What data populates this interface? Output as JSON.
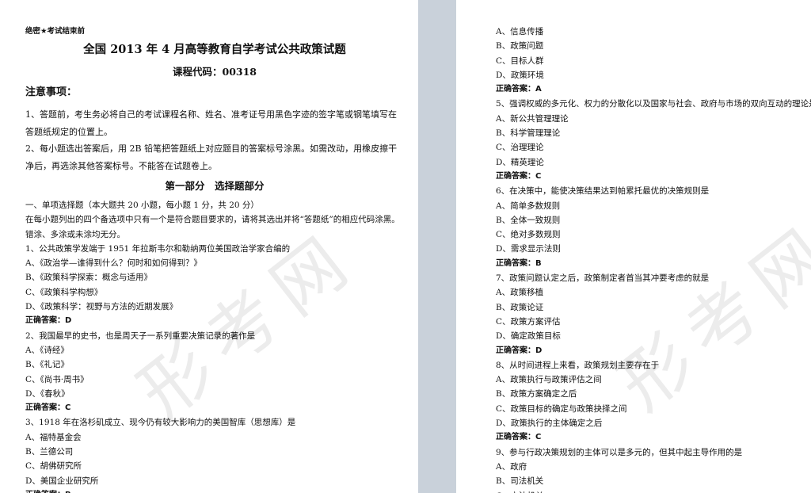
{
  "watermark": "形考网",
  "left_page": {
    "secret_label": "绝密★考试结束前",
    "title": "全国 2013 年 4 月高等教育自学考试公共政策试题",
    "course_code": "课程代码：00318",
    "notice_title": "注意事项：",
    "notice_1": "1、答题前，考生务必将自己的考试课程名称、姓名、准考证号用黑色字迹的签字笔或钢笔填写在答题纸规定的位置上。",
    "notice_2": "2、每小题选出答案后，用 2B 铅笔把答题纸上对应题目的答案标号涂黑。如需改动，用橡皮擦干净后，再选涂其他答案标号。不能答在试题卷上。",
    "section_title": "第一部分　选择题部分",
    "instr_1": "一、单项选择题（本大题共 20 小题，每小题 1 分，共 20 分）",
    "instr_2": "在每小题列出的四个备选项中只有一个是符合题目要求的，请将其选出并将“答题纸”的相应代码涂黑。",
    "instr_3": "错涂、多涂或未涂均无分。",
    "lines": [
      {
        "text": "1、公共政策学发端于 1951 年拉斯韦尔和勒纳两位美国政治学家合编的",
        "bold": false
      },
      {
        "text": "A、《政治学—谁得到什么？何时和如何得到？》",
        "bold": false
      },
      {
        "text": "B、《政策科学探索：概念与适用》",
        "bold": false
      },
      {
        "text": "C、《政策科学构想》",
        "bold": false
      },
      {
        "text": "D、《政策科学：视野与方法的近期发展》",
        "bold": false
      },
      {
        "text": "正确答案：D",
        "bold": true
      },
      {
        "text": "2、我国最早的史书，也是周天子一系列重要决策记录的著作是",
        "bold": false
      },
      {
        "text": "A、《诗经》",
        "bold": false
      },
      {
        "text": "B、《礼记》",
        "bold": false
      },
      {
        "text": "C、《尚书·周书》",
        "bold": false
      },
      {
        "text": "D、《春秋》",
        "bold": false
      },
      {
        "text": "正确答案：C",
        "bold": true
      },
      {
        "text": "3、1918 年在洛杉矶成立、现今仍有较大影响力的美国智库（思想库）是",
        "bold": false
      },
      {
        "text": "A、福特基金会",
        "bold": false
      },
      {
        "text": "B、兰德公司",
        "bold": false
      },
      {
        "text": "C、胡佛研究所",
        "bold": false
      },
      {
        "text": "D、美国企业研究所",
        "bold": false
      },
      {
        "text": "正确答案：B",
        "bold": true
      }
    ]
  },
  "right_page": {
    "lines": [
      {
        "text": "A、信息传播",
        "bold": false
      },
      {
        "text": "B、政策问题",
        "bold": false
      },
      {
        "text": "C、目标人群",
        "bold": false
      },
      {
        "text": "D、政策环境",
        "bold": false
      },
      {
        "text": "正确答案：A",
        "bold": true
      },
      {
        "text": "5、强调权威的多元化、权力的分散化以及国家与社会、政府与市场的双向互动的理论是",
        "bold": false
      },
      {
        "text": "A、新公共管理理论",
        "bold": false
      },
      {
        "text": "B、科学管理理论",
        "bold": false
      },
      {
        "text": "C、治理理论",
        "bold": false
      },
      {
        "text": "D、精英理论",
        "bold": false
      },
      {
        "text": "正确答案：C",
        "bold": true
      },
      {
        "text": "6、在决策中，能使决策结果达到帕累托最优的决策规则是",
        "bold": false
      },
      {
        "text": "A、简单多数规则",
        "bold": false
      },
      {
        "text": "B、全体一致规则",
        "bold": false
      },
      {
        "text": "C、绝对多数规则",
        "bold": false
      },
      {
        "text": "D、需求显示法则",
        "bold": false
      },
      {
        "text": "正确答案：B",
        "bold": true
      },
      {
        "text": "7、政策问题认定之后，政策制定者首当其冲要考虑的就是",
        "bold": false
      },
      {
        "text": "A、政策移植",
        "bold": false
      },
      {
        "text": "B、政策论证",
        "bold": false
      },
      {
        "text": "C、政策方案评估",
        "bold": false
      },
      {
        "text": "D、确定政策目标",
        "bold": false
      },
      {
        "text": "正确答案：D",
        "bold": true
      },
      {
        "text": "8、从时间进程上来看，政策规划主要存在于",
        "bold": false
      },
      {
        "text": "A、政策执行与政策评估之间",
        "bold": false
      },
      {
        "text": "B、政策方案确定之后",
        "bold": false
      },
      {
        "text": "C、政策目标的确定与政策抉择之间",
        "bold": false
      },
      {
        "text": "D、政策执行的主体确定之后",
        "bold": false
      },
      {
        "text": "正确答案：C",
        "bold": true
      },
      {
        "text": "9、参与行政决策规划的主体可以是多元的，但其中起主导作用的是",
        "bold": false
      },
      {
        "text": "A、政府",
        "bold": false
      },
      {
        "text": "B、司法机关",
        "bold": false
      },
      {
        "text": "C、立法机关",
        "bold": false
      }
    ]
  }
}
